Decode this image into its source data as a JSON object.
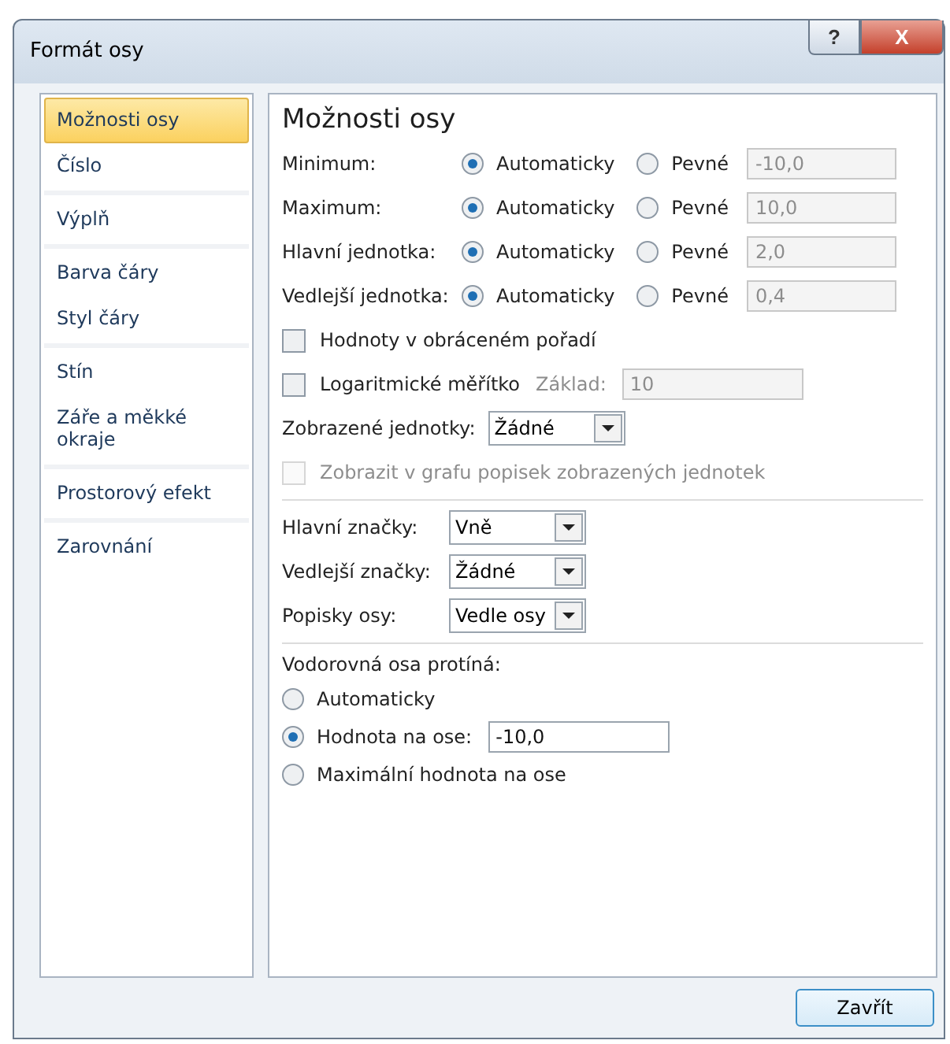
{
  "window": {
    "title": "Formát osy",
    "help": "?",
    "close": "X"
  },
  "sidebar": {
    "groups": [
      [
        {
          "label": "Možnosti osy",
          "selected": true
        },
        {
          "label": "Číslo",
          "selected": false
        }
      ],
      [
        {
          "label": "Výplň",
          "selected": false
        }
      ],
      [
        {
          "label": "Barva čáry",
          "selected": false
        },
        {
          "label": "Styl čáry",
          "selected": false
        }
      ],
      [
        {
          "label": "Stín",
          "selected": false
        },
        {
          "label": "Záře a měkké okraje",
          "selected": false
        }
      ],
      [
        {
          "label": "Prostorový efekt",
          "selected": false
        }
      ],
      [
        {
          "label": "Zarovnání",
          "selected": false
        }
      ]
    ]
  },
  "panel": {
    "heading": "Možnosti osy",
    "bounds": [
      {
        "label": "Minimum:",
        "auto_label": "Automaticky",
        "fixed_label": "Pevné",
        "auto_selected": true,
        "value": "-10,0"
      },
      {
        "label": "Maximum:",
        "auto_label": "Automaticky",
        "fixed_label": "Pevné",
        "auto_selected": true,
        "value": "10,0"
      },
      {
        "label": "Hlavní jednotka:",
        "auto_label": "Automaticky",
        "fixed_label": "Pevné",
        "auto_selected": true,
        "value": "2,0"
      },
      {
        "label": "Vedlejší jednotka:",
        "auto_label": "Automaticky",
        "fixed_label": "Pevné",
        "auto_selected": true,
        "value": "0,4"
      }
    ],
    "reverse": {
      "label": "Hodnoty v obráceném pořadí",
      "checked": false,
      "disabled": false
    },
    "log": {
      "label": "Logaritmické měřítko",
      "checked": false,
      "base_label": "Základ:",
      "base_value": "10"
    },
    "display_units": {
      "label": "Zobrazené jednotky:",
      "value": "Žádné"
    },
    "show_units_label": {
      "label": "Zobrazit v grafu popisek zobrazených jednotek",
      "checked": false,
      "disabled": true
    },
    "selects": [
      {
        "label": "Hlavní značky:",
        "value": "Vně"
      },
      {
        "label": "Vedlejší značky:",
        "value": "Žádné"
      },
      {
        "label": "Popisky osy:",
        "value": "Vedle osy"
      }
    ],
    "crosses": {
      "label": "Vodorovná osa protíná:",
      "options": [
        {
          "label": "Automaticky",
          "selected": false
        },
        {
          "label": "Hodnota na ose:",
          "selected": true,
          "value": "-10,0"
        },
        {
          "label": "Maximální hodnota na ose",
          "selected": false
        }
      ]
    }
  },
  "buttons": [
    {
      "label": "Zavřít"
    }
  ]
}
